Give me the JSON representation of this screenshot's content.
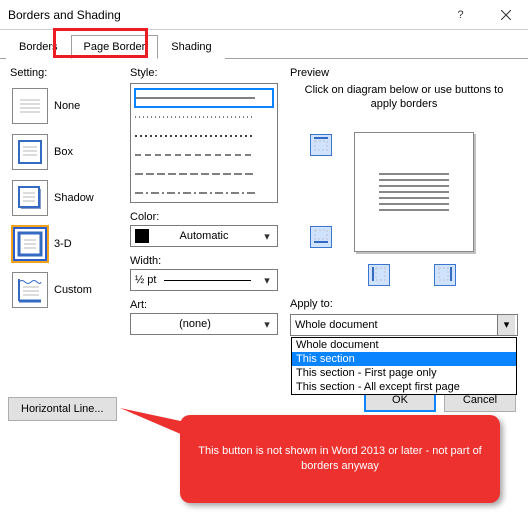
{
  "title": "Borders and Shading",
  "tabs": {
    "borders": "Borders",
    "page_border": "Page Border",
    "shading": "Shading"
  },
  "setting": {
    "label": "Setting:",
    "options": {
      "none": "None",
      "box": "Box",
      "shadow": "Shadow",
      "threeD": "3-D",
      "custom": "Custom"
    }
  },
  "style": {
    "label": "Style:",
    "color_label": "Color:",
    "color_value": "Automatic",
    "width_label": "Width:",
    "width_value": "½ pt",
    "art_label": "Art:",
    "art_value": "(none)"
  },
  "preview": {
    "label": "Preview",
    "hint": "Click on diagram below or use buttons to apply borders"
  },
  "apply": {
    "label": "Apply to:",
    "value": "Whole document",
    "options": [
      "Whole document",
      "This section",
      "This section - First page only",
      "This section - All except first page"
    ],
    "selected_index": 1
  },
  "buttons": {
    "hline": "Horizontal Line...",
    "ok": "OK",
    "cancel": "Cancel"
  },
  "callout_text": "This button is not shown in Word 2013 or later - not part of borders anyway"
}
